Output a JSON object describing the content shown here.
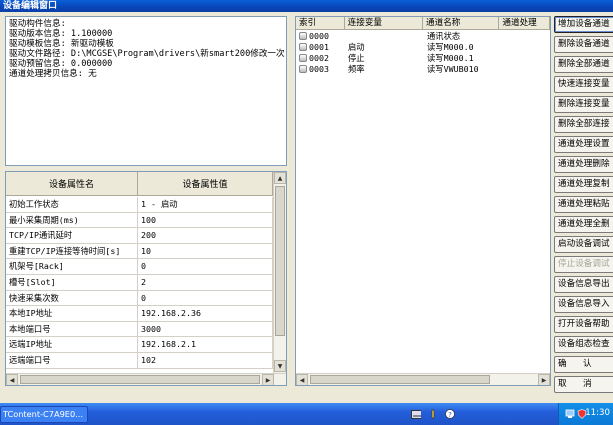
{
  "window": {
    "title": "设备编辑窗口"
  },
  "info": {
    "lines": [
      "驱动构件信息:",
      "驱动版本信息: 1.100000",
      "驱动模板信息: 新驱动模板",
      "驱动文件路径: D:\\MCGSE\\Program\\drivers\\新smart200修改一次",
      "驱动预留信息: 0.000000",
      "通道处理拷贝信息: 无"
    ]
  },
  "property_grid": {
    "headers": [
      "设备属性名",
      "设备属性值"
    ],
    "rows": [
      [
        "初始工作状态",
        "1 - 启动"
      ],
      [
        "最小采集周期(ms)",
        "100"
      ],
      [
        "TCP/IP通讯延时",
        "200"
      ],
      [
        "重建TCP/IP连接等待时间[s]",
        "10"
      ],
      [
        "机架号[Rack]",
        "0"
      ],
      [
        "槽号[Slot]",
        "2"
      ],
      [
        "快速采集次数",
        "0"
      ],
      [
        "本地IP地址",
        "192.168.2.36"
      ],
      [
        "本地端口号",
        "3000"
      ],
      [
        "远端IP地址",
        "192.168.2.1"
      ],
      [
        "远端端口号",
        "102"
      ]
    ]
  },
  "channels": {
    "headers": [
      "索引",
      "连接变量",
      "通道名称",
      "通道处理"
    ],
    "rows": [
      [
        "0000",
        "",
        "通讯状态",
        ""
      ],
      [
        "0001",
        "启动",
        "读写M000.0",
        ""
      ],
      [
        "0002",
        "停止",
        "读写M000.1",
        ""
      ],
      [
        "0003",
        "频率",
        "读写VWUB010",
        ""
      ]
    ]
  },
  "side_buttons": [
    {
      "label": "增加设备通道",
      "state": "active"
    },
    {
      "label": "删除设备通道",
      "state": "normal"
    },
    {
      "label": "删除全部通道",
      "state": "normal"
    },
    {
      "label": "快速连接变量",
      "state": "normal"
    },
    {
      "label": "删除连接变量",
      "state": "normal"
    },
    {
      "label": "删除全部连接",
      "state": "normal"
    },
    {
      "label": "通道处理设置",
      "state": "normal"
    },
    {
      "label": "通道处理删除",
      "state": "normal"
    },
    {
      "label": "通道处理复制",
      "state": "normal"
    },
    {
      "label": "通道处理粘贴",
      "state": "normal"
    },
    {
      "label": "通道处理全删",
      "state": "normal"
    },
    {
      "label": "启动设备调试",
      "state": "normal"
    },
    {
      "label": "停止设备调试",
      "state": "disabled"
    },
    {
      "label": "设备信息导出",
      "state": "normal"
    },
    {
      "label": "设备信息导入",
      "state": "normal"
    },
    {
      "label": "打开设备帮助",
      "state": "normal"
    },
    {
      "label": "设备组态检查",
      "state": "normal"
    },
    {
      "label": "确      认",
      "state": "normal"
    },
    {
      "label": "取      消",
      "state": "normal"
    }
  ],
  "taskbar": {
    "task_label": "TContent-C7A9E0...",
    "clock": "11:30"
  }
}
